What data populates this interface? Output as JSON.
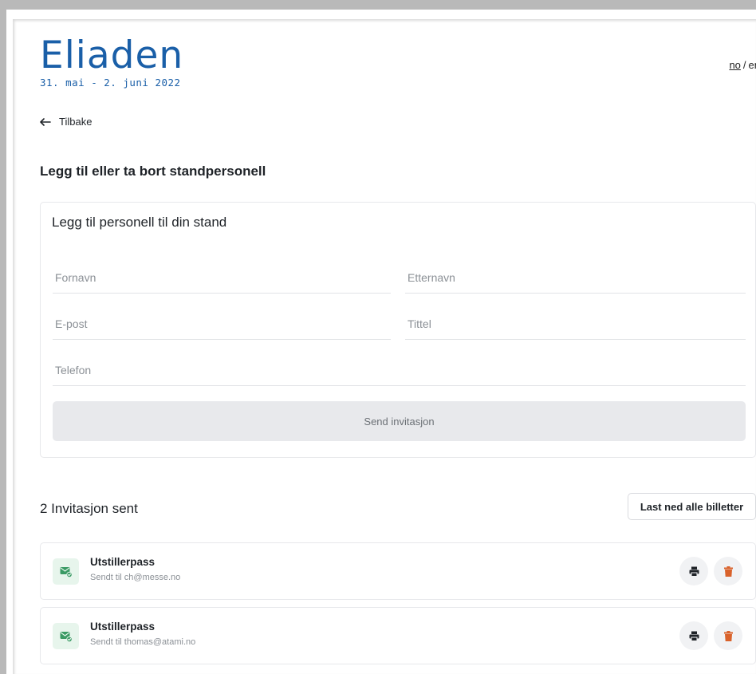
{
  "header": {
    "logo_text": "Eliaden",
    "logo_dates": "31. mai - 2. juni 2022",
    "lang_no": "no",
    "lang_sep": "/",
    "lang_en": "en"
  },
  "nav": {
    "back_label": "Tilbake"
  },
  "page_title": "Legg til eller ta bort standpersonell",
  "form": {
    "title": "Legg til personell til din stand",
    "first_name_placeholder": "Fornavn",
    "last_name_placeholder": "Etternavn",
    "email_placeholder": "E-post",
    "title_placeholder": "Tittel",
    "phone_placeholder": "Telefon",
    "submit_label": "Send invitasjon"
  },
  "invitations": {
    "heading": "2 Invitasjon sent",
    "download_all_label": "Last ned alle billetter",
    "items": [
      {
        "title": "Utstillerpass",
        "subtitle": "Sendt til ch@messe.no"
      },
      {
        "title": "Utstillerpass",
        "subtitle": "Sendt til thomas@atami.no"
      }
    ]
  },
  "colors": {
    "brand_blue": "#1a5fa8",
    "success_green": "#3a9a64",
    "delete_orange": "#d9622b"
  }
}
